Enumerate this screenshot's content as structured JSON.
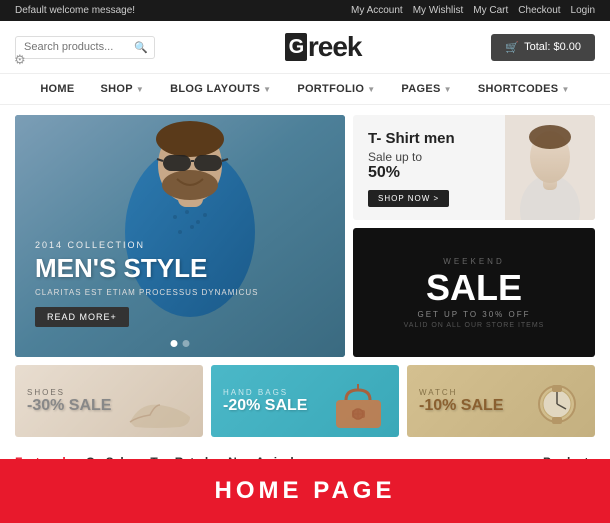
{
  "topbar": {
    "message": "Default welcome message!",
    "links": [
      "My Account",
      "My Wishlist",
      "My Cart",
      "Checkout",
      "Login"
    ]
  },
  "header": {
    "search_placeholder": "Search products...",
    "logo_letter": "G",
    "logo_text": "reek",
    "cart_label": "Total: $0.00",
    "cart_icon": "🛒"
  },
  "nav": {
    "items": [
      {
        "label": "HOME",
        "has_arrow": false
      },
      {
        "label": "SHOP",
        "has_arrow": true
      },
      {
        "label": "BLOG LAYOUTS",
        "has_arrow": true
      },
      {
        "label": "PORTFOLIO",
        "has_arrow": true
      },
      {
        "label": "PAGES",
        "has_arrow": true
      },
      {
        "label": "SHORTCODES",
        "has_arrow": true
      }
    ]
  },
  "hero": {
    "collection": "2014 COLLECTION",
    "title": "MEN'S STYLE",
    "subtitle": "CLARITAS EST ETIAM PROCESSUS DYNAMICUS",
    "read_more": "READ MORE+"
  },
  "panel_tshirt": {
    "title": "T- Shirt men",
    "sale_text": "Sale up to",
    "percent": "50%",
    "shop_now": "SHOP NOW >"
  },
  "panel_sale": {
    "weekend": "WEEKEND",
    "title": "SALE",
    "subtitle": "GET UP TO 30% OFF",
    "valid": "VALID ON ALL OUR STORE ITEMS"
  },
  "banners": [
    {
      "category": "SHOES",
      "sale": "-30% SALE"
    },
    {
      "category": "HAND BAGS",
      "sale": "-20% SALE"
    },
    {
      "category": "WATCH",
      "sale": "-10% SALE"
    }
  ],
  "tabs": {
    "featured": "Featured",
    "on_sale": "On Sale",
    "top_rated": "Top Rated",
    "new_arrivals": "New Arrivals",
    "products": "Products"
  },
  "overlay": {
    "label": "HOME PAGE"
  }
}
